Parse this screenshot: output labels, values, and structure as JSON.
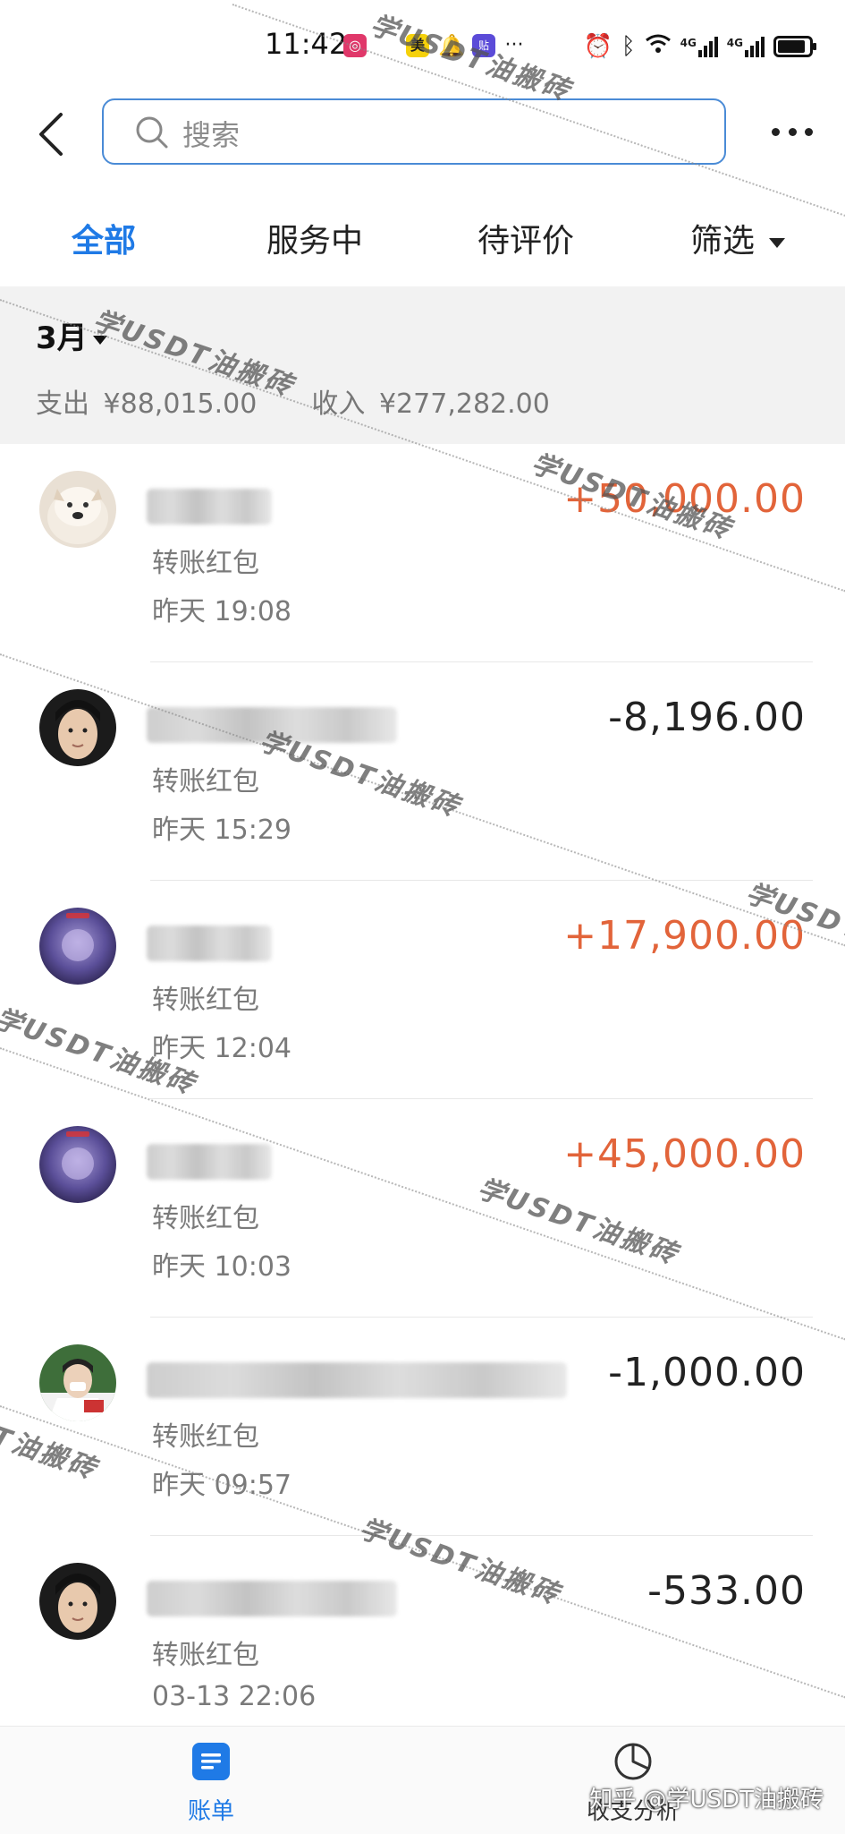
{
  "status_bar": {
    "time": "11:42",
    "app_badge_1": "美",
    "more": "···",
    "network_1": "4G",
    "network_2": "4G"
  },
  "header": {
    "search_placeholder": "搜索"
  },
  "tabs": [
    {
      "label": "全部",
      "active": true
    },
    {
      "label": "服务中",
      "active": false
    },
    {
      "label": "待评价",
      "active": false
    },
    {
      "label": "筛选",
      "active": false
    }
  ],
  "summary": {
    "month": "3月",
    "expense_label": "支出",
    "expense_value": "¥88,015.00",
    "income_label": "收入",
    "income_value": "¥277,282.00"
  },
  "transactions": [
    {
      "type": "转账红包",
      "time": "昨天  19:08",
      "amount": "+50,000.00",
      "direction": "income"
    },
    {
      "type": "转账红包",
      "time": "昨天  15:29",
      "amount": "-8,196.00",
      "direction": "expense"
    },
    {
      "type": "转账红包",
      "time": "昨天  12:04",
      "amount": "+17,900.00",
      "direction": "income"
    },
    {
      "type": "转账红包",
      "time": "昨天  10:03",
      "amount": "+45,000.00",
      "direction": "income"
    },
    {
      "type": "转账红包",
      "time": "昨天  09:57",
      "amount": "-1,000.00",
      "direction": "expense"
    },
    {
      "type": "转账红包",
      "time": "03-13  22:06",
      "amount": "-533.00",
      "direction": "expense"
    }
  ],
  "bottom_nav": [
    {
      "label": "账单",
      "icon": "bill-icon",
      "active": true
    },
    {
      "label": "收支分析",
      "icon": "pie-chart-icon",
      "active": false
    }
  ],
  "watermark": "学USDT油搬砖",
  "credit": "知乎 @学USDT油搬砖",
  "colors": {
    "accent": "#1f7ae6",
    "income": "#e2643a",
    "expense": "#222222"
  }
}
